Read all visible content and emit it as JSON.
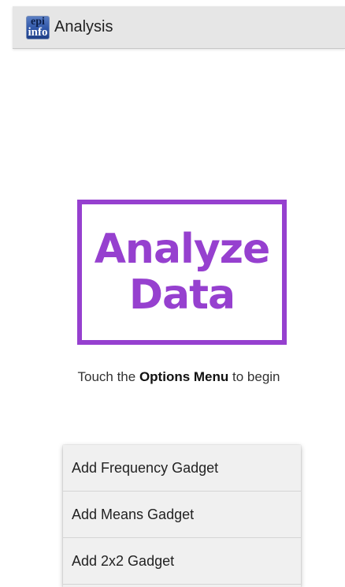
{
  "action_bar": {
    "title": "Analysis",
    "icon": {
      "line1": "epi",
      "line2": "info"
    }
  },
  "logo": {
    "line1": "Analyze",
    "line2": "Data",
    "color": "#9640cf"
  },
  "hint": {
    "prefix": "Touch the",
    "bold": "Options Menu",
    "suffix": "to begin"
  },
  "menu": {
    "items": [
      {
        "label": "Add Frequency Gadget"
      },
      {
        "label": "Add Means Gadget"
      },
      {
        "label": "Add 2x2 Gadget"
      }
    ]
  }
}
